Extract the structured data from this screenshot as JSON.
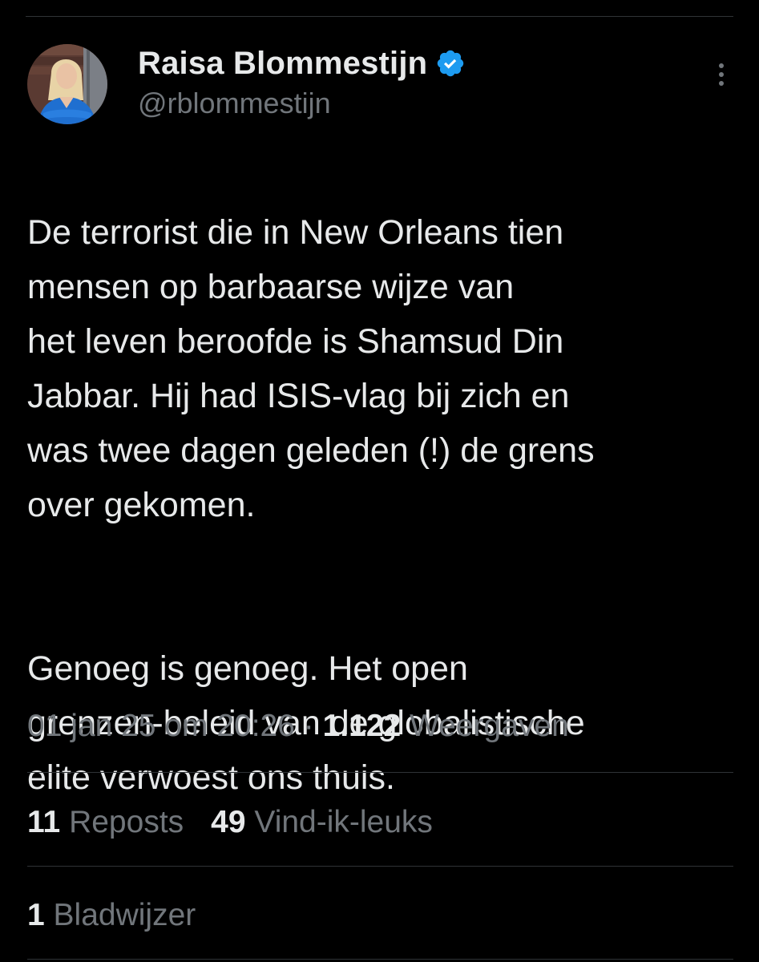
{
  "author": {
    "display_name": "Raisa Blommestijn",
    "handle": "@rblommestijn",
    "verified": true
  },
  "tweet": {
    "paragraphs": [
      "De terrorist die in New Orleans tien\nmensen op barbaarse wijze van\nhet leven beroofde is Shamsud Din\nJabbar. Hij had ISIS-vlag bij zich en\nwas twee dagen geleden (!) de grens\nover gekomen.",
      "Genoeg is genoeg. Het open\ngrenzen-beleid van de globalistische\nelite verwoest ons thuis."
    ]
  },
  "meta": {
    "timestamp": "01 jan 25 om 20:26",
    "separator": "·",
    "views_count": "1.122",
    "views_label": "Weergaven"
  },
  "stats": {
    "reposts_count": "11",
    "reposts_label": "Reposts",
    "likes_count": "49",
    "likes_label": "Vind-ik-leuks",
    "bookmarks_count": "1",
    "bookmarks_label": "Bladwijzer"
  },
  "icons": {
    "verified": "verified-badge-icon",
    "more": "more-options-icon"
  },
  "colors": {
    "background": "#000000",
    "text_primary": "#e7e9ea",
    "text_secondary": "#71767b",
    "divider": "#2f3336",
    "verified_blue": "#1d9bf0"
  }
}
